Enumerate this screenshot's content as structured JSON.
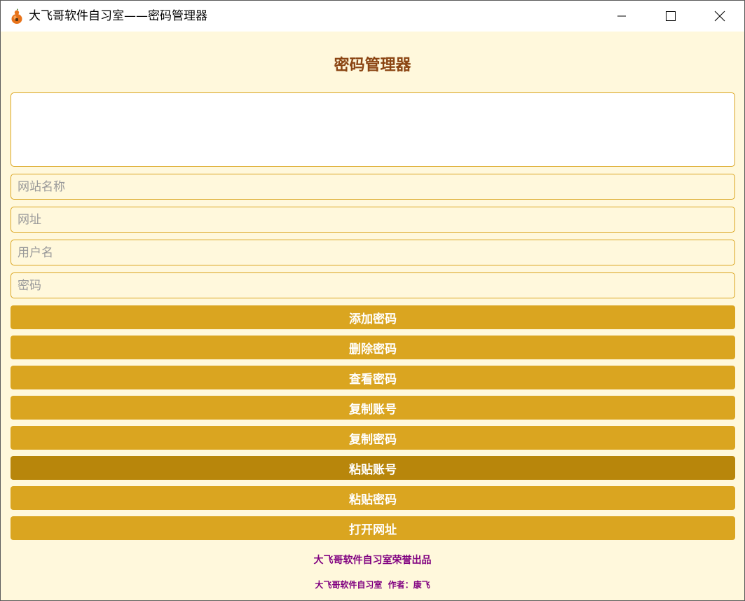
{
  "window": {
    "title": "大飞哥软件自习室——密码管理器",
    "icon": "gourd-app-icon",
    "controls": [
      "minimize-icon",
      "maximize-icon",
      "close-icon"
    ]
  },
  "app": {
    "heading": "密码管理器",
    "display_text": ""
  },
  "fields": {
    "site_name": {
      "placeholder": "网站名称",
      "value": ""
    },
    "url": {
      "placeholder": "网址",
      "value": ""
    },
    "username": {
      "placeholder": "用户名",
      "value": ""
    },
    "password": {
      "placeholder": "密码",
      "value": ""
    }
  },
  "buttons": {
    "add": "添加密码",
    "delete": "删除密码",
    "view": "查看密码",
    "copy_account": "复制账号",
    "copy_password": "复制密码",
    "paste_account": "粘贴账号",
    "paste_password": "粘贴密码",
    "open_url": "打开网址"
  },
  "footer": {
    "line1": "大飞哥软件自习室荣誉出品",
    "line2": "大飞哥软件自习室  作者：康飞"
  },
  "colors": {
    "background": "#fff8dc",
    "accent": "#daa520",
    "accent_active": "#b8860b",
    "heading": "#8b4513",
    "footer": "#800080"
  }
}
